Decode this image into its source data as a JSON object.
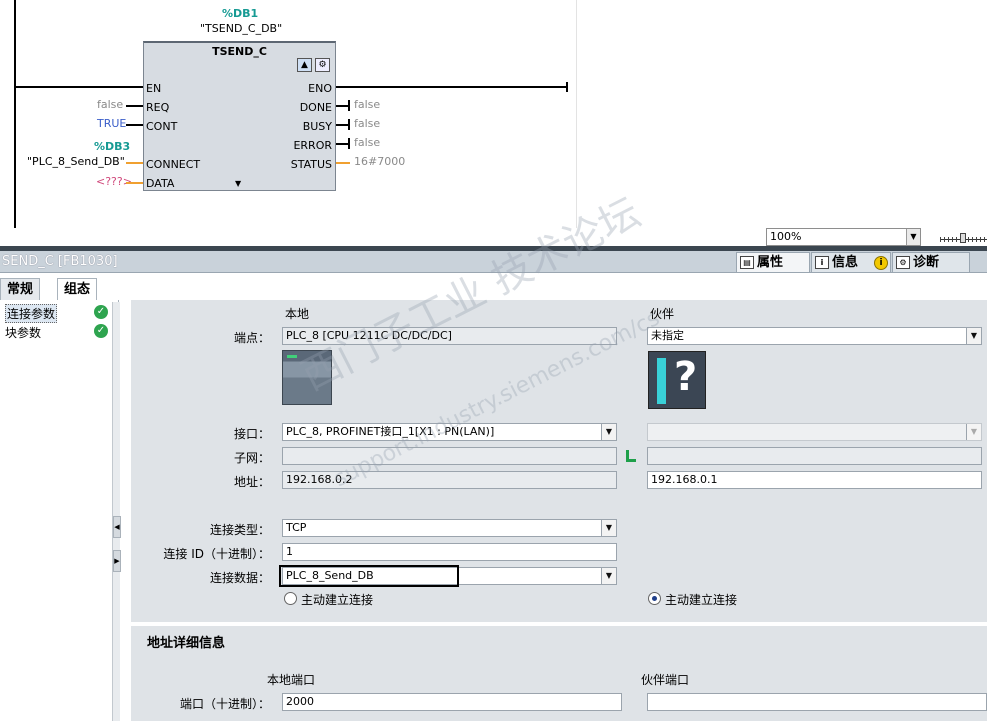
{
  "ladder": {
    "instance_db_addr": "%DB1",
    "instance_db_name": "\"TSEND_C_DB\"",
    "block_title": "TSEND_C",
    "inputs": [
      {
        "pin": "EN",
        "value": ""
      },
      {
        "pin": "REQ",
        "value": "false"
      },
      {
        "pin": "CONT",
        "value": "TRUE"
      },
      {
        "pin": "CONNECT",
        "value": "\"PLC_8_Send_DB\"",
        "db_addr": "%DB3"
      },
      {
        "pin": "DATA",
        "value": "<???>"
      }
    ],
    "outputs": [
      {
        "pin": "ENO",
        "value": ""
      },
      {
        "pin": "DONE",
        "value": "false"
      },
      {
        "pin": "BUSY",
        "value": "false"
      },
      {
        "pin": "ERROR",
        "value": "false"
      },
      {
        "pin": "STATUS",
        "value": "16#7000"
      }
    ],
    "zoom": "100%"
  },
  "inspector": {
    "title": "SEND_C [FB1030]",
    "tabs": [
      {
        "label": "属性",
        "icon": "properties-icon"
      },
      {
        "label": "信息",
        "icon": "info-icon"
      },
      {
        "label": "诊断",
        "icon": "diagnostics-icon"
      }
    ],
    "side_tabs": [
      "常规",
      "组态"
    ],
    "nav_items": [
      {
        "label": "连接参数",
        "status": "ok"
      },
      {
        "label": "块参数",
        "status": "ok"
      }
    ]
  },
  "connection": {
    "col_local": "本地",
    "col_partner": "伙伴",
    "endpoint_label": "端点：",
    "endpoint_local": "PLC_8 [CPU 1211C DC/DC/DC]",
    "endpoint_partner": "未指定",
    "interface_label": "接口：",
    "interface_local": "PLC_8, PROFINET接口_1[X1 : PN(LAN)]",
    "interface_partner": "",
    "subnet_label": "子网：",
    "subnet_local": "",
    "subnet_partner": "",
    "address_label": "地址：",
    "address_local": "192.168.0.2",
    "address_partner": "192.168.0.1",
    "conn_type_label": "连接类型：",
    "conn_type": "TCP",
    "conn_id_label": "连接 ID（十进制）：",
    "conn_id": "1",
    "conn_data_label": "连接数据：",
    "conn_data": "PLC_8_Send_DB",
    "active_local_label": "主动建立连接",
    "active_partner_label": "主动建立连接",
    "active_local": false,
    "active_partner": true
  },
  "address_details": {
    "title": "地址详细信息",
    "local_port_header": "本地端口",
    "partner_port_header": "伙伴端口",
    "port_label": "端口（十进制）：",
    "local_port": "2000",
    "partner_port": ""
  },
  "watermark": {
    "line1": "西门子工业  技术论坛",
    "line2": "support.industry.siemens.com/cs"
  }
}
